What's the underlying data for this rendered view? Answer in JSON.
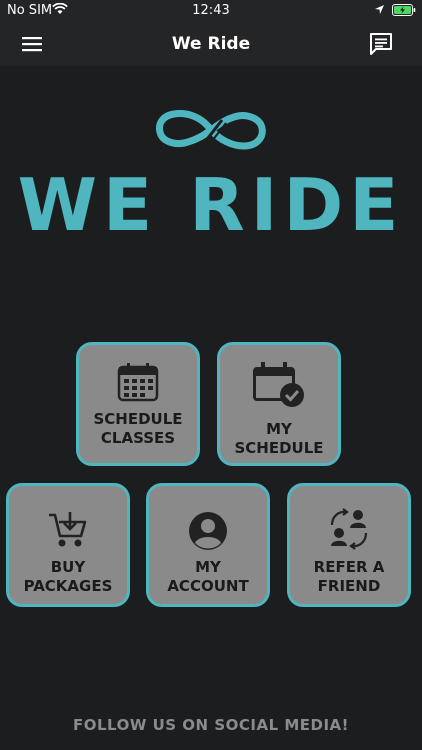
{
  "status": {
    "carrier": "No SIM",
    "time": "12:43"
  },
  "nav": {
    "title": "We Ride",
    "menu_icon": "hamburger-menu-icon",
    "chat_icon": "chat-message-icon"
  },
  "brand": {
    "logo_text": "WE RIDE",
    "accent_color": "#4fb5be"
  },
  "tiles": [
    {
      "label": "SCHEDULE\nCLASSES",
      "icon": "calendar-icon"
    },
    {
      "label": "MY\nSCHEDULE",
      "icon": "calendar-check-icon"
    },
    {
      "label": "BUY\nPACKAGES",
      "icon": "cart-download-icon"
    },
    {
      "label": "MY\nACCOUNT",
      "icon": "user-icon"
    },
    {
      "label": "REFER A\nFRIEND",
      "icon": "refer-users-icon"
    }
  ],
  "footer": {
    "text": "FOLLOW US ON SOCIAL MEDIA!"
  }
}
